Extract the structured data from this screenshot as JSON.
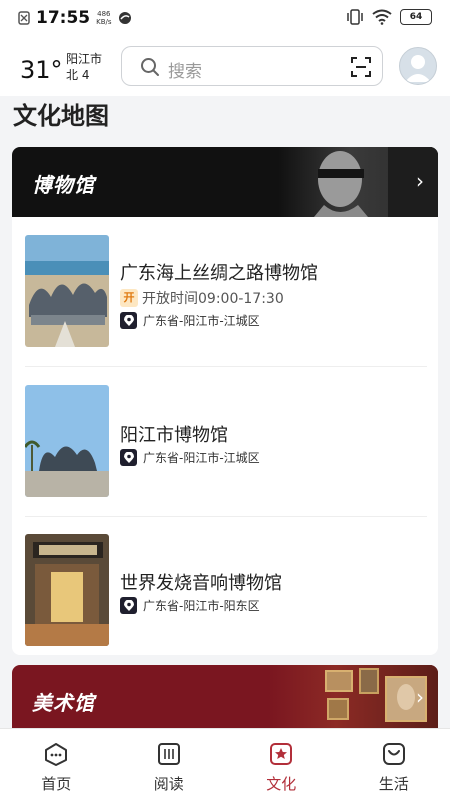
{
  "status_bar": {
    "time": "17:55",
    "net_speed_value": "486",
    "net_speed_unit": "KB/s",
    "battery": "64"
  },
  "header": {
    "temperature": "31°",
    "city": "阳江市",
    "wind": "北 4",
    "search_placeholder": "搜索"
  },
  "page_title": "文化地图",
  "museum_section": {
    "title": "博物馆",
    "items": [
      {
        "name": "广东海上丝绸之路博物馆",
        "open_badge": "开",
        "hours": "开放时间09:00-17:30",
        "address": "广东省-阳江市-江城区"
      },
      {
        "name": "阳江市博物馆",
        "address": "广东省-阳江市-江城区"
      },
      {
        "name": "世界发烧音响博物馆",
        "address": "广东省-阳江市-阳东区"
      }
    ]
  },
  "art_section": {
    "title": "美术馆"
  },
  "bottom_nav": {
    "items": [
      {
        "label": "首页",
        "icon": "home-icon"
      },
      {
        "label": "阅读",
        "icon": "book-icon"
      },
      {
        "label": "文化",
        "icon": "culture-icon",
        "active": true
      },
      {
        "label": "生活",
        "icon": "life-icon"
      }
    ]
  },
  "colors": {
    "accent": "#b22f3a",
    "art_banner": "#7a1620",
    "museum_banner": "#111111"
  }
}
